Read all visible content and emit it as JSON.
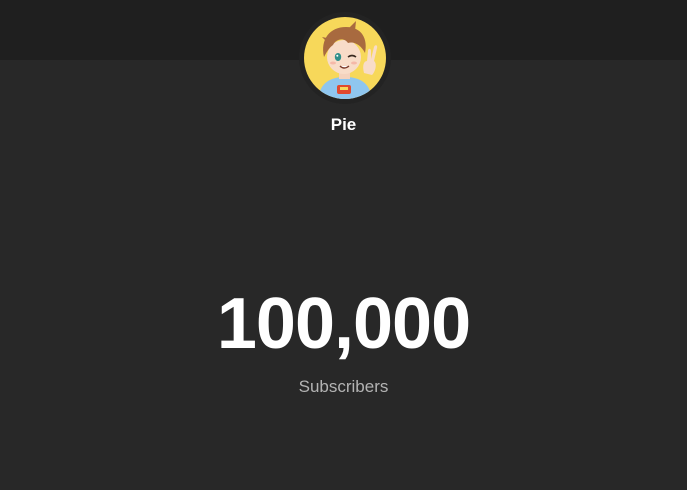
{
  "channel": {
    "name": "Pie",
    "avatar_icon": "cartoon-avatar-icon"
  },
  "stats": {
    "subscriber_count": "100,000",
    "subscriber_label": "Subscribers"
  },
  "colors": {
    "background": "#282828",
    "banner": "#1f1f1f",
    "avatar_background": "#f7d85a",
    "text_primary": "#ffffff",
    "text_secondary": "#b3b3b3"
  }
}
